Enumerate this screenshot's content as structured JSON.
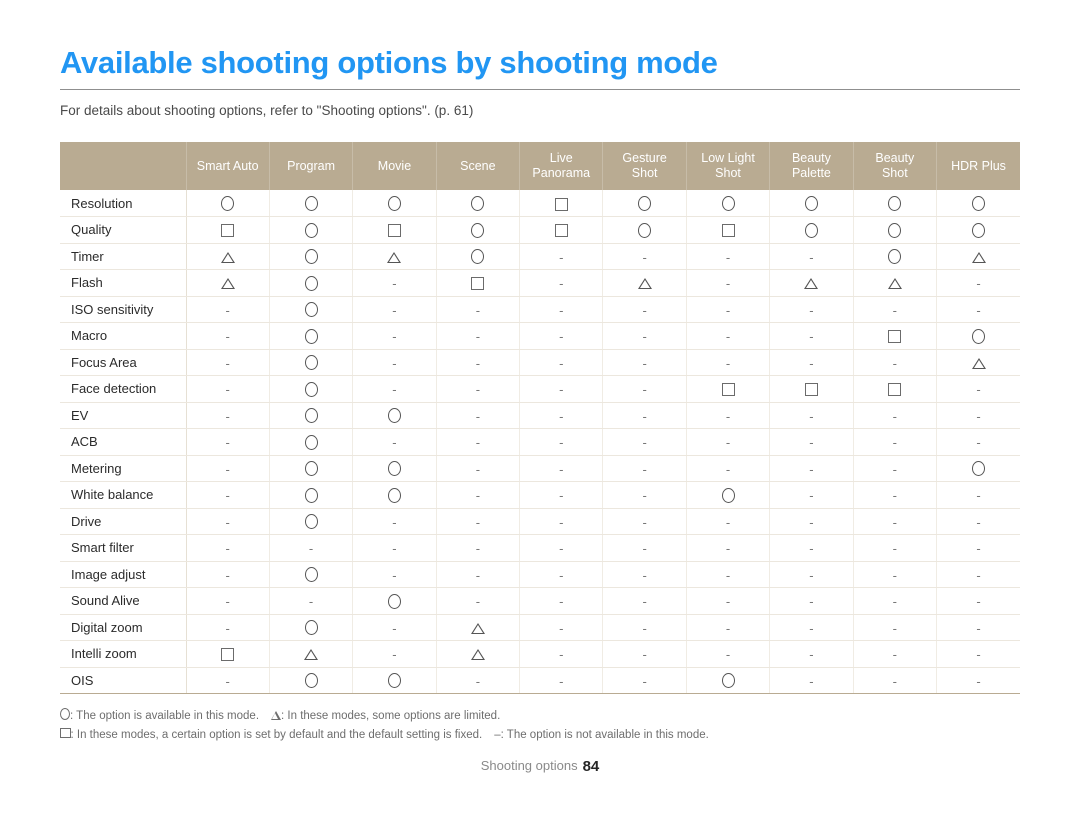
{
  "header": {
    "title": "Available shooting options by shooting mode",
    "subtitle": "For details about shooting options, refer to \"Shooting options\". (p. 61)",
    "title_color": "#2196f3"
  },
  "table": {
    "header_bg": "#b9ab92",
    "corner_label": "",
    "columns": [
      "Smart Auto",
      "Program",
      "Movie",
      "Scene",
      "Live Panorama",
      "Gesture Shot",
      "Low Light Shot",
      "Beauty Palette",
      "Beauty Shot",
      "HDR Plus"
    ],
    "rows": [
      {
        "label": "Resolution",
        "cells": [
          "circle",
          "circle",
          "circle",
          "circle",
          "square",
          "circle",
          "circle",
          "circle",
          "circle",
          "circle"
        ]
      },
      {
        "label": "Quality",
        "cells": [
          "square",
          "circle",
          "square",
          "circle",
          "square",
          "circle",
          "square",
          "circle",
          "circle",
          "circle"
        ]
      },
      {
        "label": "Timer",
        "cells": [
          "triangle",
          "circle",
          "triangle",
          "circle",
          "dash",
          "dash",
          "dash",
          "dash",
          "circle",
          "triangle"
        ]
      },
      {
        "label": "Flash",
        "cells": [
          "triangle",
          "circle",
          "dash",
          "square",
          "dash",
          "triangle",
          "dash",
          "triangle",
          "triangle",
          "dash"
        ]
      },
      {
        "label": "ISO sensitivity",
        "cells": [
          "dash",
          "circle",
          "dash",
          "dash",
          "dash",
          "dash",
          "dash",
          "dash",
          "dash",
          "dash"
        ]
      },
      {
        "label": "Macro",
        "cells": [
          "dash",
          "circle",
          "dash",
          "dash",
          "dash",
          "dash",
          "dash",
          "dash",
          "square",
          "circle"
        ]
      },
      {
        "label": "Focus Area",
        "cells": [
          "dash",
          "circle",
          "dash",
          "dash",
          "dash",
          "dash",
          "dash",
          "dash",
          "dash",
          "triangle"
        ]
      },
      {
        "label": "Face detection",
        "cells": [
          "dash",
          "circle",
          "dash",
          "dash",
          "dash",
          "dash",
          "square",
          "square",
          "square",
          "dash"
        ]
      },
      {
        "label": "EV",
        "cells": [
          "dash",
          "circle",
          "circle",
          "dash",
          "dash",
          "dash",
          "dash",
          "dash",
          "dash",
          "dash"
        ]
      },
      {
        "label": "ACB",
        "cells": [
          "dash",
          "circle",
          "dash",
          "dash",
          "dash",
          "dash",
          "dash",
          "dash",
          "dash",
          "dash"
        ]
      },
      {
        "label": "Metering",
        "cells": [
          "dash",
          "circle",
          "circle",
          "dash",
          "dash",
          "dash",
          "dash",
          "dash",
          "dash",
          "circle"
        ]
      },
      {
        "label": "White balance",
        "cells": [
          "dash",
          "circle",
          "circle",
          "dash",
          "dash",
          "dash",
          "circle",
          "dash",
          "dash",
          "dash"
        ]
      },
      {
        "label": "Drive",
        "cells": [
          "dash",
          "circle",
          "dash",
          "dash",
          "dash",
          "dash",
          "dash",
          "dash",
          "dash",
          "dash"
        ]
      },
      {
        "label": "Smart filter",
        "cells": [
          "dash",
          "dash",
          "dash",
          "dash",
          "dash",
          "dash",
          "dash",
          "dash",
          "dash",
          "dash"
        ]
      },
      {
        "label": "Image adjust",
        "cells": [
          "dash",
          "circle",
          "dash",
          "dash",
          "dash",
          "dash",
          "dash",
          "dash",
          "dash",
          "dash"
        ]
      },
      {
        "label": "Sound Alive",
        "cells": [
          "dash",
          "dash",
          "circle",
          "dash",
          "dash",
          "dash",
          "dash",
          "dash",
          "dash",
          "dash"
        ]
      },
      {
        "label": "Digital zoom",
        "cells": [
          "dash",
          "circle",
          "dash",
          "triangle",
          "dash",
          "dash",
          "dash",
          "dash",
          "dash",
          "dash"
        ]
      },
      {
        "label": "Intelli zoom",
        "cells": [
          "square",
          "triangle",
          "dash",
          "triangle",
          "dash",
          "dash",
          "dash",
          "dash",
          "dash",
          "dash"
        ]
      },
      {
        "label": "OIS",
        "cells": [
          "dash",
          "circle",
          "circle",
          "dash",
          "dash",
          "dash",
          "circle",
          "dash",
          "dash",
          "dash"
        ]
      }
    ]
  },
  "legend": {
    "circle_text": ": The option is available in this mode.",
    "triangle_text": ": In these modes, some options are limited.",
    "square_text": ": In these modes, a certain option is set by default and the default setting is fixed.",
    "dash_symbol": "–",
    "dash_text": ": The option is not available in this mode."
  },
  "footer": {
    "section": "Shooting options",
    "page_number": "84"
  }
}
